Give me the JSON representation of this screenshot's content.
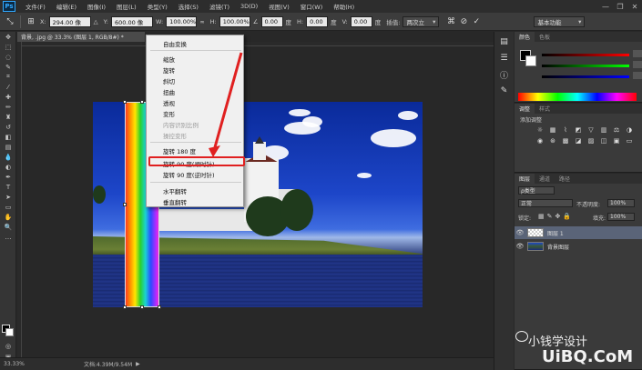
{
  "app": {
    "logo": "Ps"
  },
  "menubar": [
    "文件(F)",
    "编辑(E)",
    "图像(I)",
    "图层(L)",
    "类型(Y)",
    "选择(S)",
    "滤镜(T)",
    "3D(D)",
    "视图(V)",
    "窗口(W)",
    "帮助(H)"
  ],
  "window_controls": [
    "—",
    "❐",
    "✕"
  ],
  "options": {
    "x_label": "X:",
    "x_value": "294.00 像",
    "y_label": "Y:",
    "y_value": "600.00 像",
    "w_label": "W:",
    "w_value": "100.00%",
    "h_label": "H:",
    "h_value": "100.00%",
    "angle_value": "0.00",
    "angle_unit": "度",
    "hskew_label": "H:",
    "hskew_value": "0.00",
    "hskew_unit": "度",
    "v_label": "V:",
    "v_value": "0.00",
    "v_unit": "度",
    "interp_label": "插值:",
    "interp_value": "两次立",
    "workspace": "基本功能"
  },
  "document": {
    "tab": "背景, .jpg @ 33.3% (图层 1, RGB/8#) *",
    "zoom": "33.33%",
    "doc_size": "文档:4.39M/9.54M"
  },
  "context_menu": {
    "items": [
      {
        "label": "自由变换",
        "disabled": false
      },
      {
        "label": "缩放",
        "disabled": false
      },
      {
        "label": "旋转",
        "disabled": false
      },
      {
        "label": "斜切",
        "disabled": false
      },
      {
        "label": "扭曲",
        "disabled": false
      },
      {
        "label": "透视",
        "disabled": false
      },
      {
        "label": "变形",
        "disabled": false
      },
      {
        "label": "内容识别比例",
        "disabled": true
      },
      {
        "label": "操控变形",
        "disabled": true
      },
      {
        "label": "旋转 180 度",
        "disabled": false
      },
      {
        "label": "旋转 90 度(顺时针)",
        "disabled": false
      },
      {
        "label": "旋转 90 度(逆时针)",
        "disabled": false
      },
      {
        "label": "水平翻转",
        "disabled": false
      },
      {
        "label": "垂直翻转",
        "disabled": false
      }
    ]
  },
  "panels": {
    "color": {
      "tabs": [
        "颜色",
        "色板"
      ]
    },
    "adjust": {
      "tabs": [
        "调整",
        "样式"
      ],
      "title": "添加调整"
    },
    "layers": {
      "tabs": [
        "图层",
        "通道",
        "路径"
      ],
      "kind": "ρ类型",
      "blend": "正常",
      "opacity_label": "不透明度:",
      "opacity": "100%",
      "lock_label": "锁定:",
      "fill_label": "填充:",
      "fill": "100%",
      "items": [
        {
          "name": "图层 1",
          "selected": true
        },
        {
          "name": "背景图层",
          "selected": false
        }
      ]
    }
  },
  "watermark": {
    "line1": "小钱学设计",
    "line2": "UiBQ.CoM"
  },
  "colors": {
    "highlight": "#e02020",
    "menubar": "#2d2d2d",
    "canvas": "#282828"
  }
}
